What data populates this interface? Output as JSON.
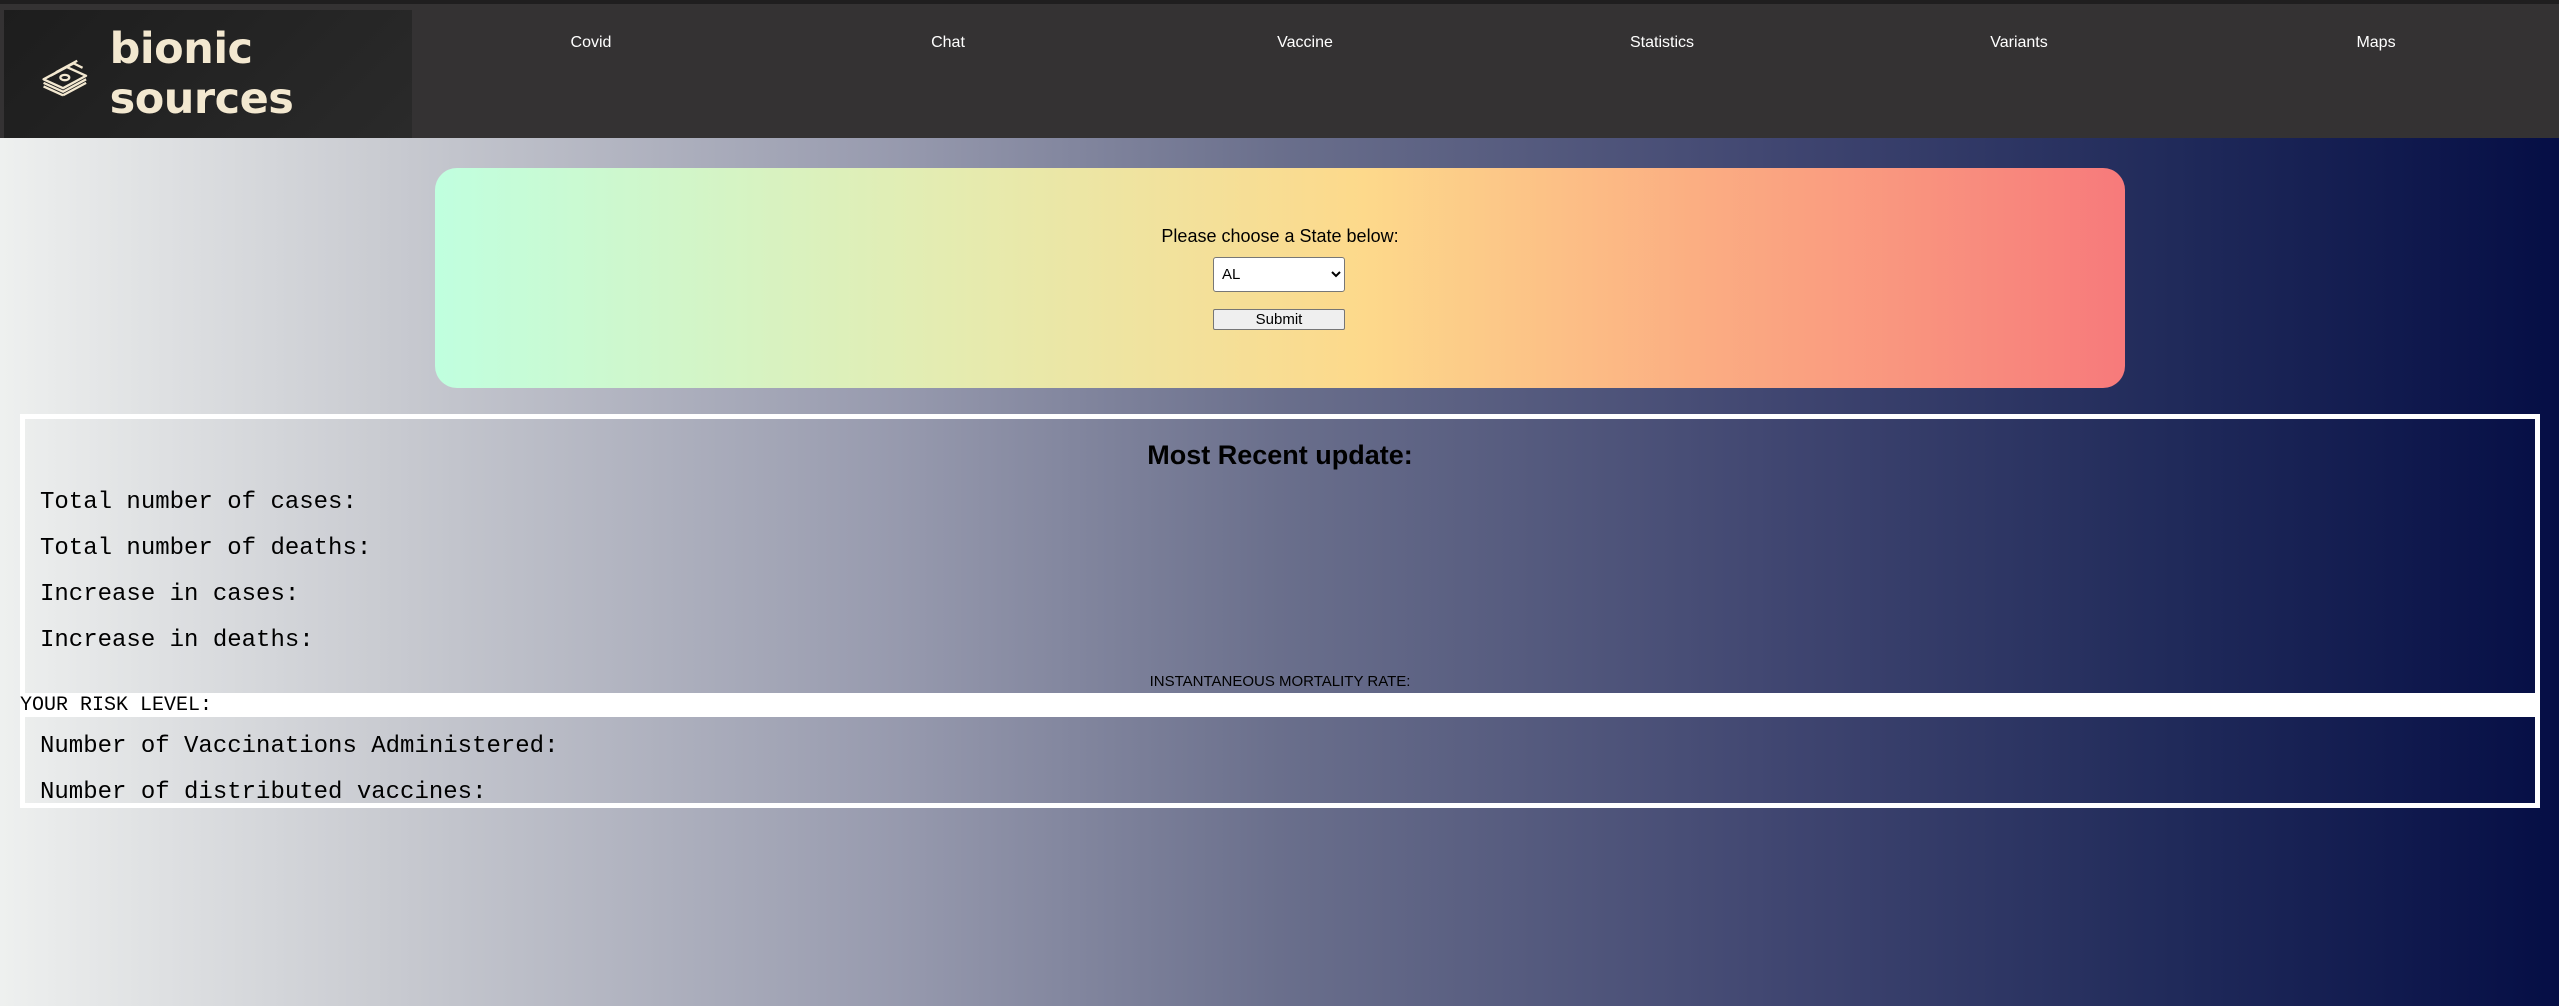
{
  "header": {
    "logo_text": "bionic sources",
    "logo_icon": "money-stack-icon",
    "nav": [
      "Covid",
      "Chat",
      "Vaccine",
      "Statistics",
      "Variants",
      "Maps"
    ]
  },
  "form": {
    "label": "Please choose a State below:",
    "state_selected": "AL",
    "submit_label": "Submit"
  },
  "stats": {
    "title": "Most Recent update:",
    "total_cases_label": "Total number of cases:",
    "total_deaths_label": "Total number of deaths:",
    "increase_cases_label": "Increase in cases:",
    "increase_deaths_label": "Increase in deaths:",
    "mortality_label": "INSTANTANEOUS MORTALITY RATE:",
    "risk_label": "YOUR RISK LEVEL:",
    "vaccinations_label": "Number of Vaccinations Administered:",
    "distributed_label": "Number of distributed vaccines:"
  },
  "colors": {
    "topbar": "#343233",
    "logo_text": "#f3e8d0",
    "panel_gradient_start": "#c0ffdf",
    "panel_gradient_mid": "#fdd98b",
    "panel_gradient_end": "#f77a7b",
    "page_gradient_start": "#eef0ef",
    "page_gradient_end": "#050e45"
  }
}
